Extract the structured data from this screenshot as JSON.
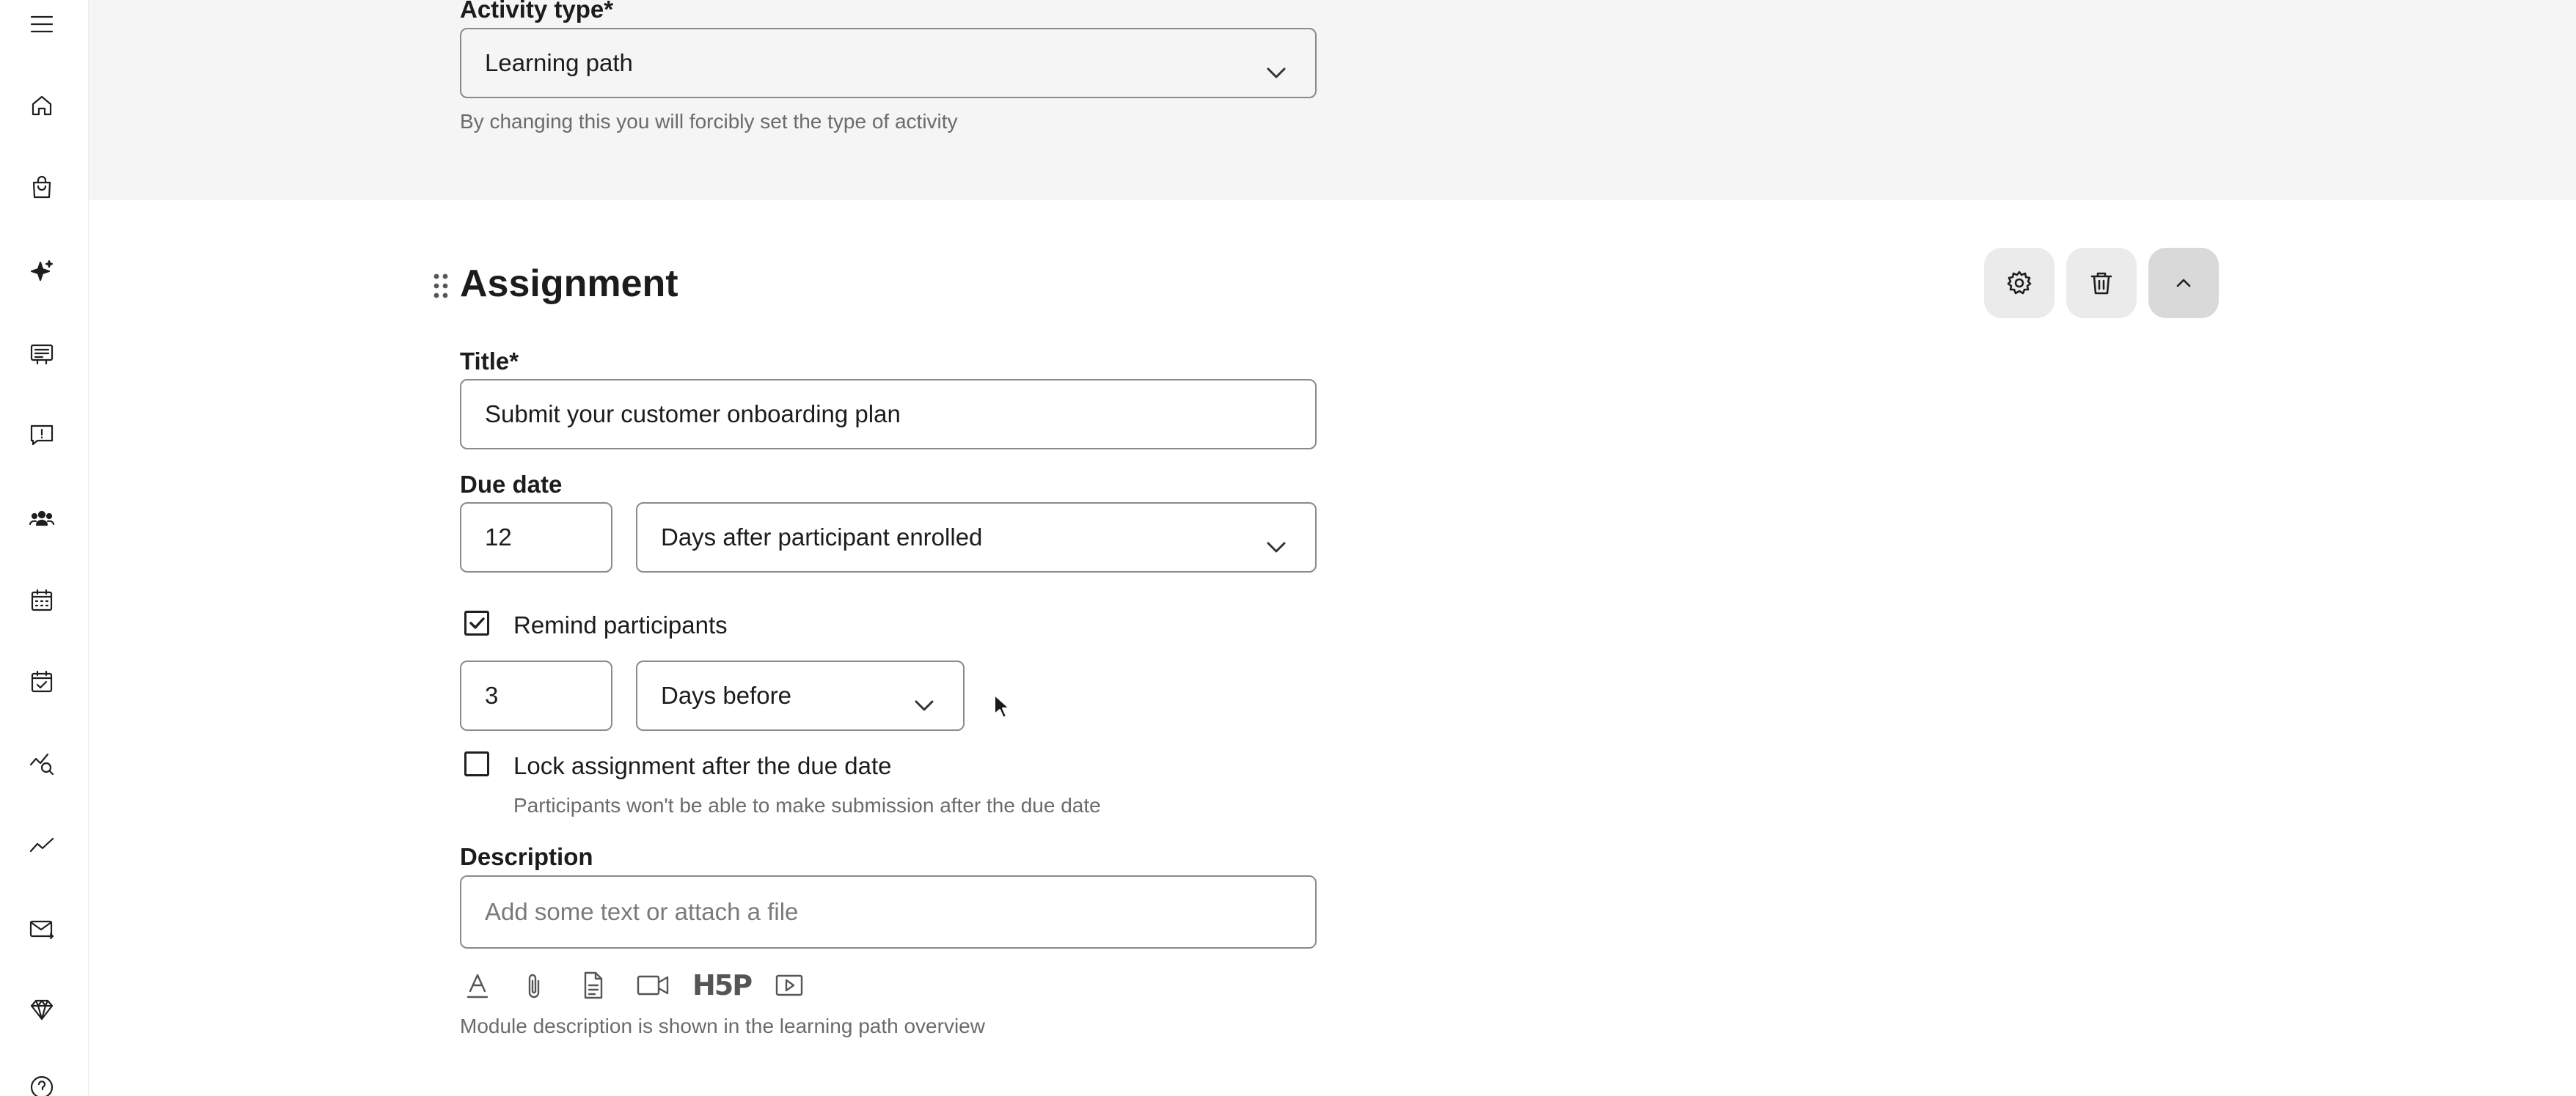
{
  "sidebar": {
    "icons": [
      "menu-icon",
      "home-icon",
      "shopping-bag-icon",
      "sparkles-icon",
      "presentation-icon",
      "feedback-icon",
      "people-icon",
      "calendar-icon",
      "calendar-check-icon",
      "analytics-search-icon",
      "trend-line-icon",
      "mail-icon",
      "diamond-icon",
      "help-icon"
    ]
  },
  "activity_type": {
    "label": "Activity type*",
    "value": "Learning path",
    "helper": "By changing this you will forcibly set the type of activity"
  },
  "assignment": {
    "heading": "Assignment",
    "title_label": "Title*",
    "title_value": "Submit your customer onboarding plan",
    "due_date_label": "Due date",
    "due_date_value": "12",
    "due_date_unit": "Days after participant enrolled",
    "remind_label": "Remind participants",
    "remind_checked": true,
    "remind_value": "3",
    "remind_unit": "Days before",
    "lock_label": "Lock assignment after the due date",
    "lock_checked": false,
    "lock_helper": "Participants won't be able to make submission after the due date",
    "description_label": "Description",
    "description_placeholder": "Add some text or attach a file",
    "description_helper": "Module description is shown in the learning path overview",
    "toolbar_h5p": "H5P"
  },
  "actions": {
    "icons": [
      "settings-icon",
      "trash-icon",
      "chevron-up-icon"
    ]
  },
  "colors": {
    "top_background": "#f5f5f5",
    "border": "#8a8a8a",
    "action_button": "#ebebeb"
  }
}
